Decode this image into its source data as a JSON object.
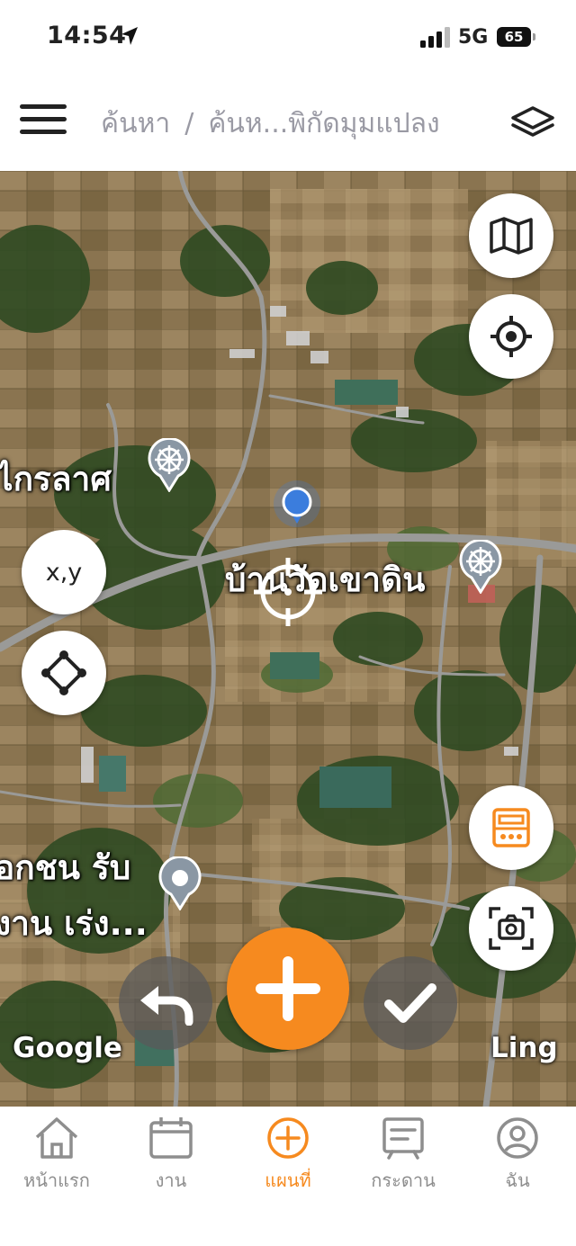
{
  "status_bar": {
    "time": "14:54",
    "network": "5G",
    "battery": "65"
  },
  "header": {
    "breadcrumb": [
      "ค้นหา",
      "ค้นห...พิกัดมุมแปลง"
    ],
    "separator": "/"
  },
  "map": {
    "place_labels": {
      "temple_left": "ไกรลาศ",
      "village": "บ้านวัดเขาดิน",
      "poi_line1": "อกชน รับ",
      "poi_line2": "งาน เร่ง..."
    },
    "attribution_left": "Google",
    "attribution_right": "Ling",
    "buttons": {
      "xy_label": "x,y"
    }
  },
  "colors": {
    "accent": "#f68a1f",
    "location_dot": "#3b7ddd",
    "tab_inactive": "#8e8e8e"
  },
  "icons": {
    "map_type": "map-icon",
    "locate": "crosshair-icon",
    "polygon": "polygon-icon",
    "calculator": "calculator-icon",
    "screenshot": "camera-icon",
    "undo": "undo-icon",
    "add": "plus-icon",
    "confirm": "check-icon"
  },
  "tabs": [
    {
      "label": "หน้าแรก",
      "icon": "home-icon",
      "active": false
    },
    {
      "label": "งาน",
      "icon": "calendar-icon",
      "active": false
    },
    {
      "label": "แผนที่",
      "icon": "plus-circle-icon",
      "active": true
    },
    {
      "label": "กระดาน",
      "icon": "board-icon",
      "active": false
    },
    {
      "label": "ฉัน",
      "icon": "user-icon",
      "active": false
    }
  ]
}
